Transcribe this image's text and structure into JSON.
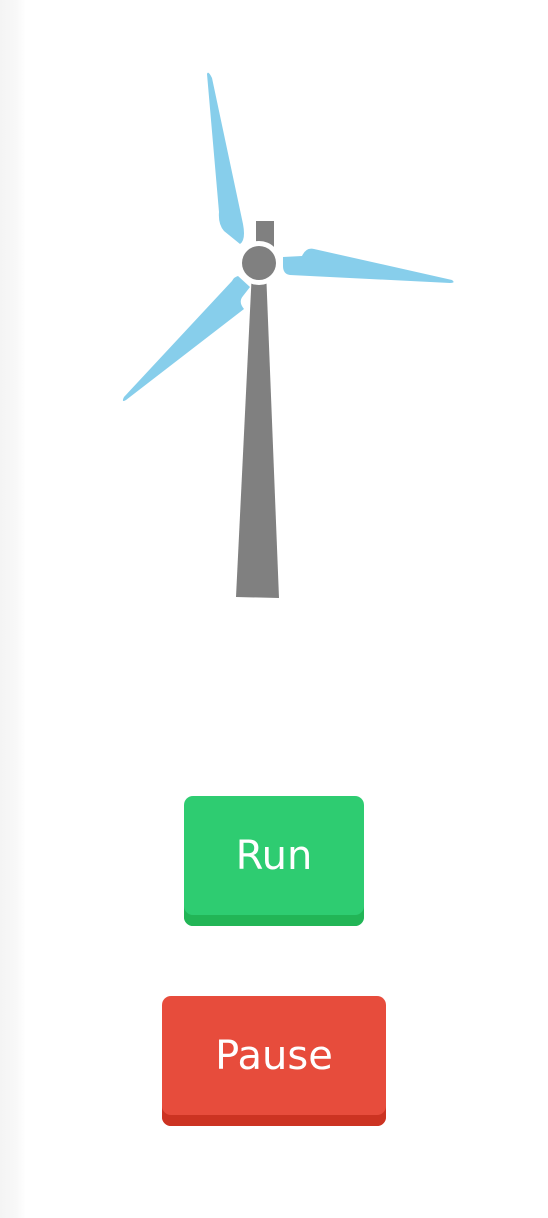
{
  "turbine": {
    "blade_color": "#87ceeb",
    "tower_color": "#808080",
    "hub_color": "#808080"
  },
  "controls": {
    "run_label": "Run",
    "run_color": "#2ecc71",
    "pause_label": "Pause",
    "pause_color": "#e74c3c"
  }
}
